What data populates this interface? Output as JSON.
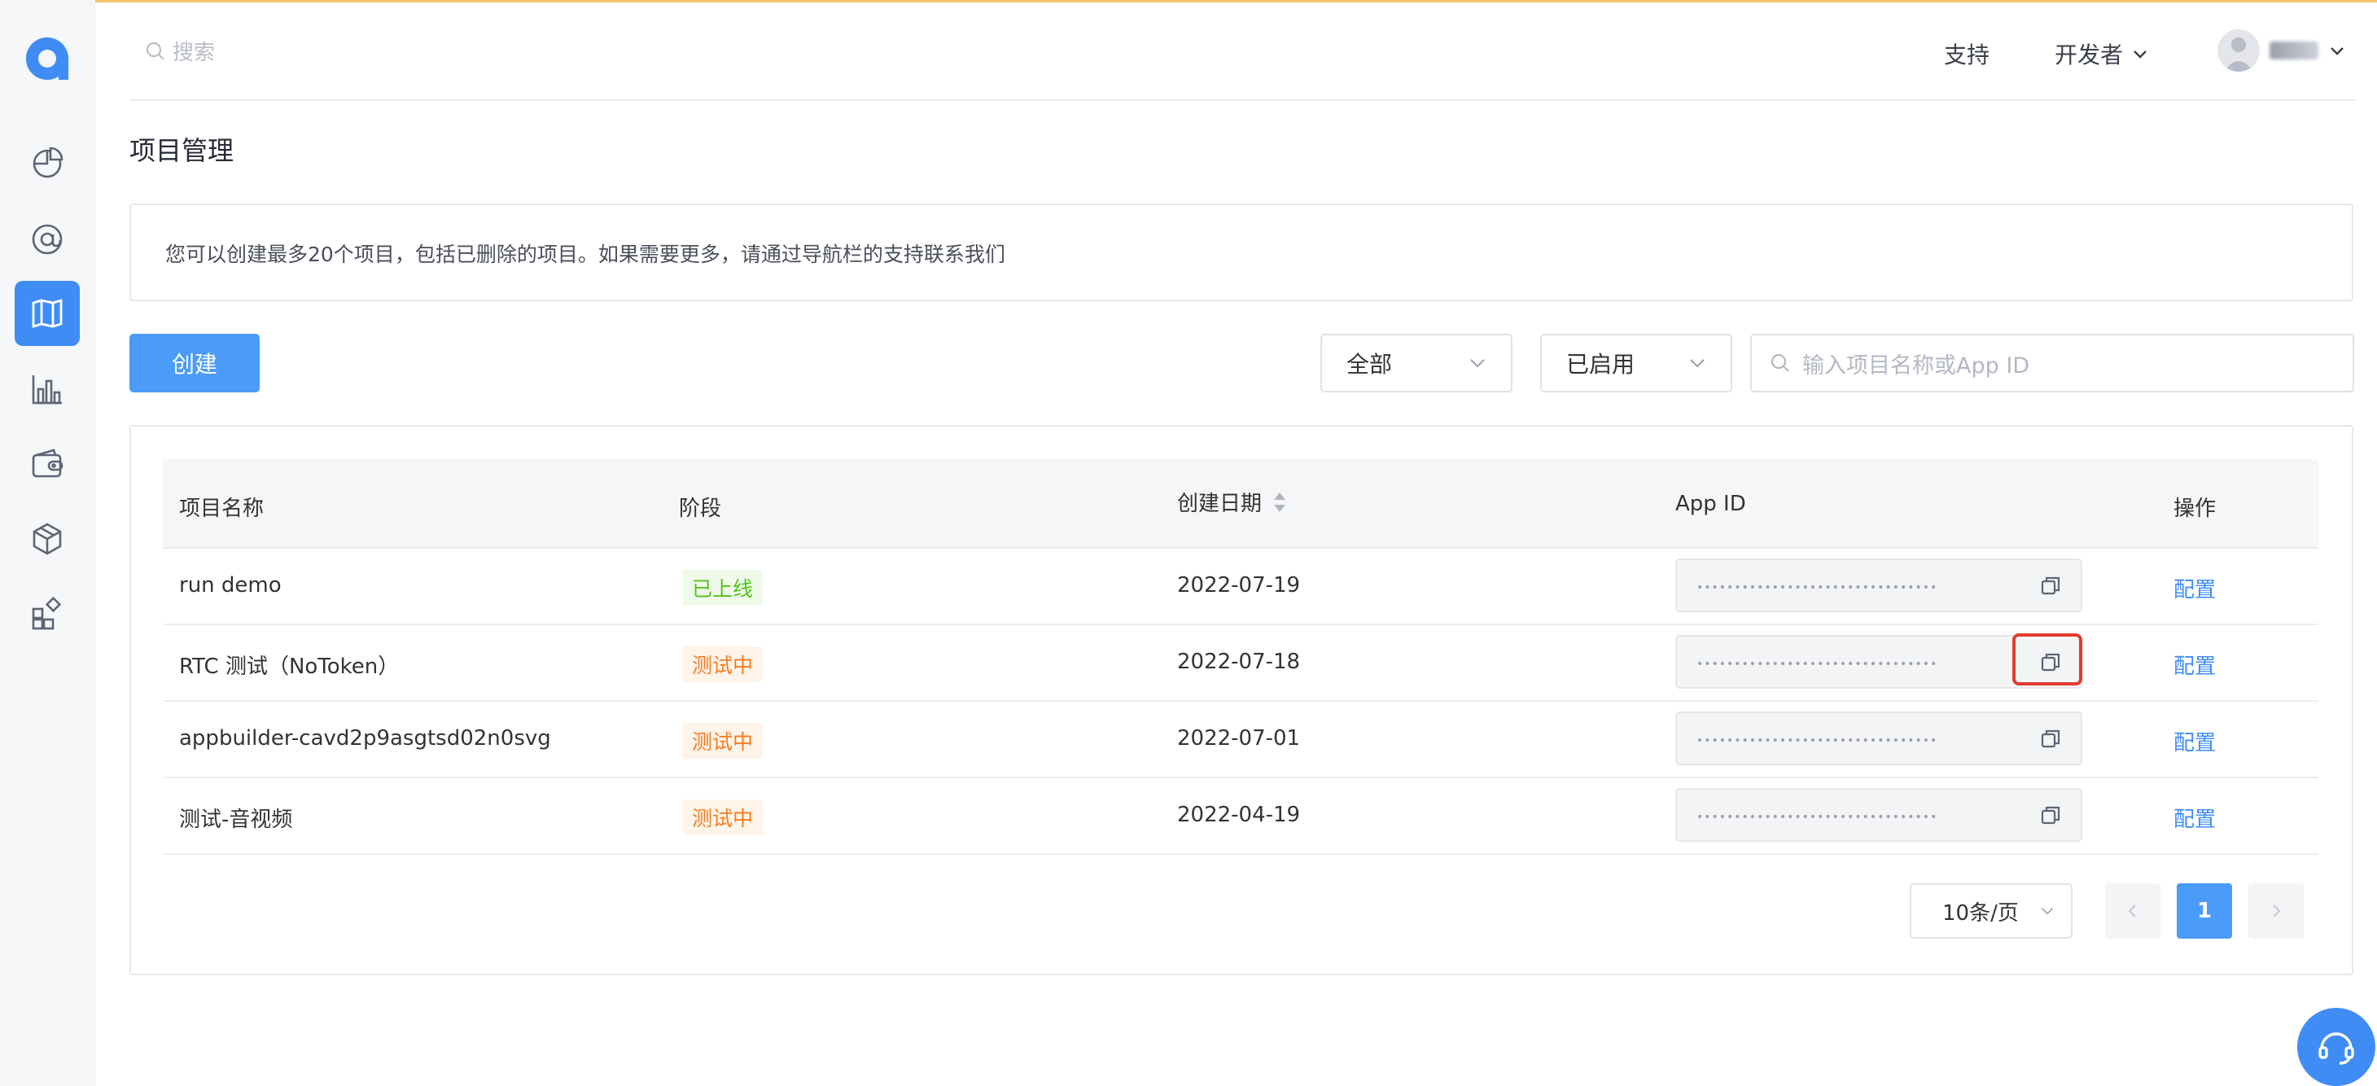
{
  "header": {
    "search_placeholder": "搜索",
    "support": "支持",
    "developer": "开发者"
  },
  "page": {
    "title": "项目管理",
    "notice": "您可以创建最多20个项目，包括已删除的项目。如果需要更多，请通过导航栏的支持联系我们",
    "create_label": "创建",
    "filter_all": "全部",
    "filter_status": "已启用",
    "search_placeholder": "输入项目名称或App ID"
  },
  "table": {
    "headers": {
      "name": "项目名称",
      "stage": "阶段",
      "date": "创建日期",
      "appid": "App ID",
      "action": "操作"
    },
    "rows": [
      {
        "name": "run demo",
        "stage": "已上线",
        "date": "2022-07-19",
        "appid": "••••••••••••••••••••••••••••••••",
        "action": "配置"
      },
      {
        "name": "RTC 测试（NoToken）",
        "stage": "测试中",
        "date": "2022-07-18",
        "appid": "••••••••••••••••••••••••••••••••",
        "action": "配置"
      },
      {
        "name": "appbuilder-cavd2p9asgtsd02n0svg",
        "stage": "测试中",
        "date": "2022-07-01",
        "appid": "••••••••••••••••••••••••••••••••",
        "action": "配置"
      },
      {
        "name": "测试-音视频",
        "stage": "测试中",
        "date": "2022-04-19",
        "appid": "••••••••••••••••••••••••••••••••",
        "action": "配置"
      }
    ]
  },
  "pagination": {
    "page_size": "10条/页",
    "current_page": "1"
  },
  "colors": {
    "primary": "#3f8cf5",
    "online": "#52c41a",
    "testing": "#f57c1f",
    "highlight": "#e33b2e"
  },
  "icons": [
    "pie-chart-icon",
    "at-icon",
    "map-icon",
    "bar-chart-icon",
    "wallet-icon",
    "cube-icon",
    "grid-plus-icon",
    "search-icon",
    "copy-icon",
    "headset-icon"
  ]
}
